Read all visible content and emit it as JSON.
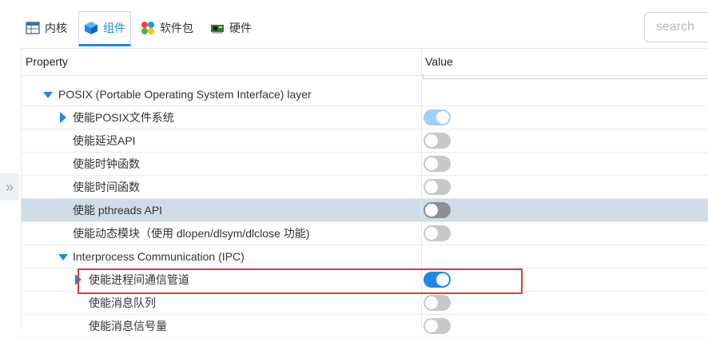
{
  "tabs": [
    {
      "label": "内核",
      "icon": "kernel-table-icon"
    },
    {
      "label": "组件",
      "icon": "component-cube-icon"
    },
    {
      "label": "软件包",
      "icon": "package-colorful-icon"
    },
    {
      "label": "硬件",
      "icon": "hardware-board-icon"
    }
  ],
  "search": {
    "placeholder": "search"
  },
  "table": {
    "columns": {
      "property": "Property",
      "value": "Value"
    },
    "rows": [
      {
        "label": "POSIX (Portable Operating System Interface) layer",
        "level": 0,
        "expander": "expanded"
      },
      {
        "label": "使能POSIX文件系统",
        "level": 1,
        "expander": "collapsed",
        "toggle": "on-disabled"
      },
      {
        "label": "使能延迟API",
        "level": 1,
        "toggle": "off"
      },
      {
        "label": "使能时钟函数",
        "level": 1,
        "toggle": "off"
      },
      {
        "label": "使能时间函数",
        "level": 1,
        "toggle": "off"
      },
      {
        "label": "使能 pthreads API",
        "level": 1,
        "toggle": "off",
        "selected": true
      },
      {
        "label": "使能动态模块（使用 dlopen/dlsym/dlclose 功能)",
        "level": 1,
        "toggle": "off"
      },
      {
        "label": "Interprocess Communication (IPC)",
        "level": 1,
        "expander": "expanded"
      },
      {
        "label": "使能进程间通信管道",
        "level": 2,
        "expander": "collapsed",
        "toggle": "on"
      },
      {
        "label": "使能消息队列",
        "level": 2,
        "toggle": "off"
      },
      {
        "label": "使能消息信号量",
        "level": 2,
        "toggle": "off"
      }
    ]
  },
  "colors": {
    "accent": "#1e88e5",
    "selected_row": "#cfdde9",
    "highlight": "#e53935"
  }
}
